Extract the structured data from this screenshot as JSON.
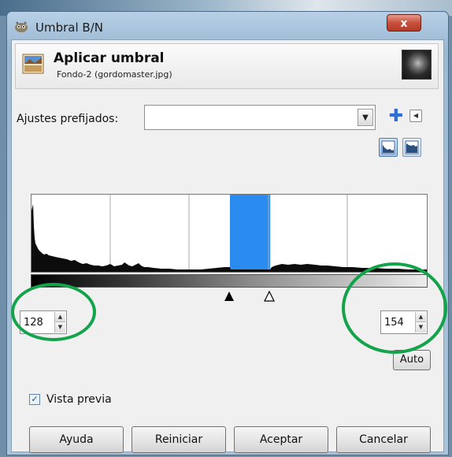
{
  "window": {
    "title": "Umbral B/N",
    "close_label": "x"
  },
  "header": {
    "title": "Aplicar umbral",
    "subtitle": "Fondo-2 (gordomaster.jpg)",
    "icon": "threshold-tool-icon",
    "thumbnail": "image-thumbnail"
  },
  "presets": {
    "label": "Ajustes prefijados:",
    "value": "",
    "add_icon": "plus-icon",
    "menu_icon": "triangle-left-icon"
  },
  "histogram": {
    "scale_buttons": [
      "linear-histogram-icon",
      "log-histogram-icon"
    ],
    "low": 128,
    "high": 154,
    "range_max": 255,
    "highlight_color": "#2a8cf0"
  },
  "threshold": {
    "low_value": "128",
    "high_value": "154",
    "auto_label": "Auto"
  },
  "preview": {
    "label": "Vista previa",
    "checked": true
  },
  "buttons": {
    "help": "Ayuda",
    "reset": "Reiniciar",
    "ok": "Aceptar",
    "cancel": "Cancelar"
  },
  "annotation_color": "#13a34a"
}
